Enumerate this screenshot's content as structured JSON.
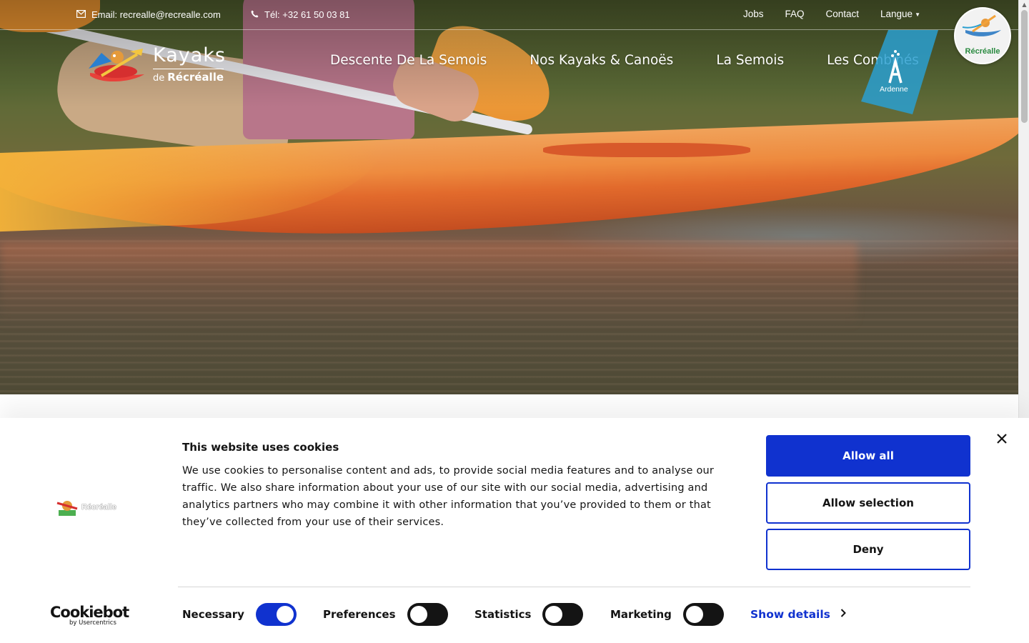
{
  "topbar": {
    "email_text": "Email: recrealle@recrealle.com",
    "phone_text": "Tél: +32 61 50 03 81",
    "links": [
      "Jobs",
      "FAQ",
      "Contact",
      "Langue"
    ]
  },
  "brand": {
    "title": "Kayaks",
    "sub_prefix": "de",
    "sub_name": "Récréalle"
  },
  "nav": {
    "items": [
      "Descente De La Semois",
      "Nos Kayaks & Canoës",
      "La Semois",
      "Les Combinés"
    ]
  },
  "badges": {
    "ardenne": "Ardenne",
    "round": "Récréalle"
  },
  "cookie": {
    "logo_text": "Récréalle",
    "title": "This website uses cookies",
    "text": "We use cookies to personalise content and ads, to provide social media features and to analyse our traffic. We also share information about your use of our site with our social media, advertising and analytics partners who may combine it with other information that you’ve provided to them or that they’ve collected from your use of their services.",
    "allow_all": "Allow all",
    "allow_selection": "Allow selection",
    "deny": "Deny",
    "cookiebot_name": "Cookiebot",
    "cookiebot_sub": "by Usercentrics",
    "consents": [
      {
        "label": "Necessary",
        "on": true
      },
      {
        "label": "Preferences",
        "on": false
      },
      {
        "label": "Statistics",
        "on": false
      },
      {
        "label": "Marketing",
        "on": false
      }
    ],
    "show_details": "Show details"
  },
  "colors": {
    "accent": "#1032cf",
    "text": "#141414",
    "ardenne_blue": "#2a9fd0"
  },
  "icons": [
    "envelope-icon",
    "phone-icon",
    "caret-down-icon",
    "close-icon",
    "chevron-right-icon"
  ]
}
